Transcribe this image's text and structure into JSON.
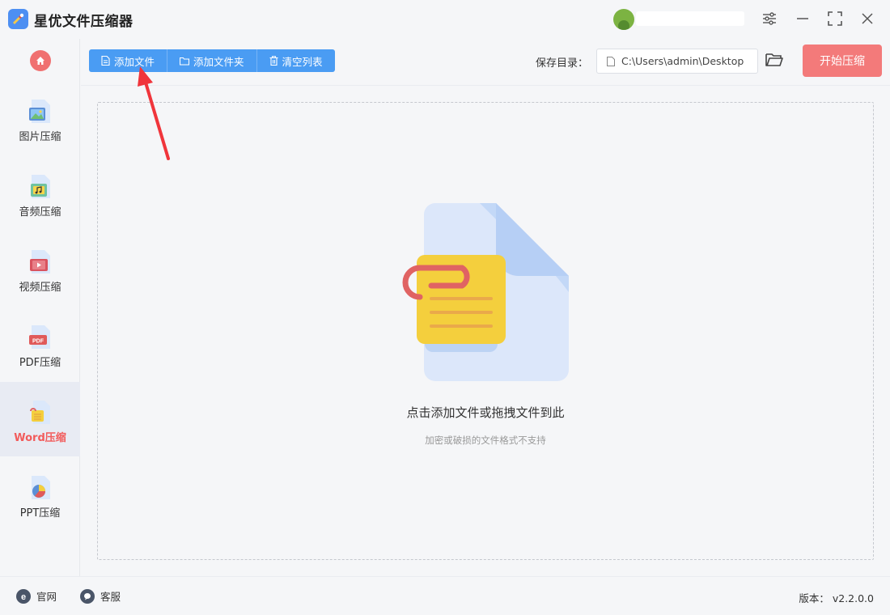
{
  "app": {
    "title": "星优文件压缩器"
  },
  "sidebar": {
    "items": [
      {
        "label": "图片压缩",
        "icon": "image-file-icon"
      },
      {
        "label": "音频压缩",
        "icon": "audio-file-icon"
      },
      {
        "label": "视频压缩",
        "icon": "video-file-icon"
      },
      {
        "label": "PDF压缩",
        "icon": "pdf-file-icon"
      },
      {
        "label": "Word压缩",
        "icon": "word-file-icon",
        "active": true
      },
      {
        "label": "PPT压缩",
        "icon": "ppt-file-icon"
      }
    ]
  },
  "toolbar": {
    "add_file": "添加文件",
    "add_folder": "添加文件夹",
    "clear_list": "清空列表",
    "save_label": "保存目录：",
    "save_path": "C:\\Users\\admin\\Desktop",
    "start": "开始压缩"
  },
  "dropzone": {
    "main_text": "点击添加文件或拖拽文件到此",
    "sub_text": "加密或破损的文件格式不支持"
  },
  "footer": {
    "website": "官网",
    "support": "客服",
    "version_label": "版本：",
    "version": "v2.2.0.0"
  },
  "colors": {
    "accent_blue": "#4a9cf3",
    "start_red": "#f37a7a",
    "active_red": "#f25b5b"
  }
}
